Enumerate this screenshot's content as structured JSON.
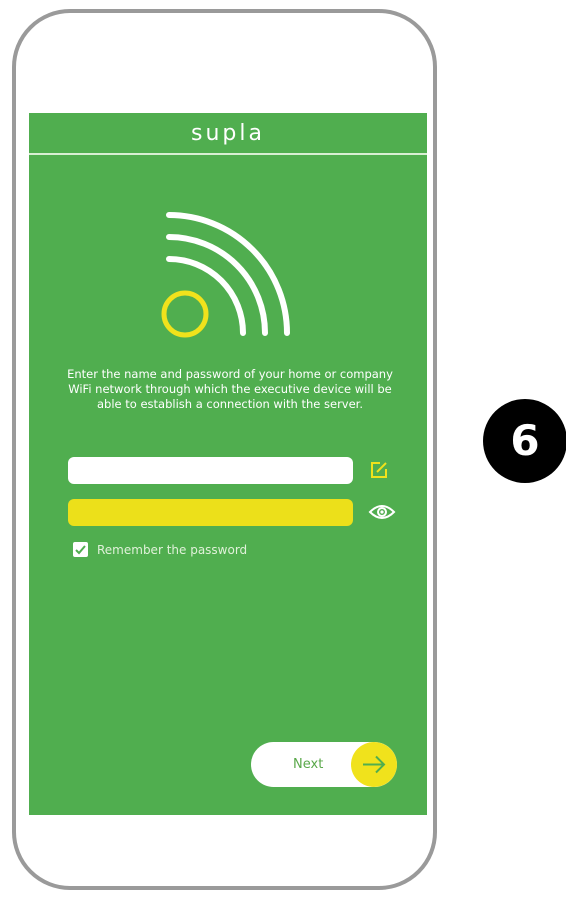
{
  "app": {
    "title": "supla"
  },
  "instructions": "Enter the name and password of your home or company WiFi network through which the executive device will be able to establish a connection with the server.",
  "wifi_form": {
    "ssid_value": "",
    "password_value": "",
    "remember_label": "Remember the password",
    "remember_checked": true
  },
  "next_button": {
    "label": "Next"
  },
  "step_badge": {
    "number": "6"
  },
  "colors": {
    "screen_bg": "#50ae4f",
    "accent_yellow": "#f0e21c",
    "phone_frame": "#9a9a9a"
  },
  "icons": {
    "logo": "supla-signal-logo",
    "edit": "edit-icon",
    "show_password": "eye-icon",
    "arrow": "arrow-right-icon",
    "check": "check-icon"
  }
}
